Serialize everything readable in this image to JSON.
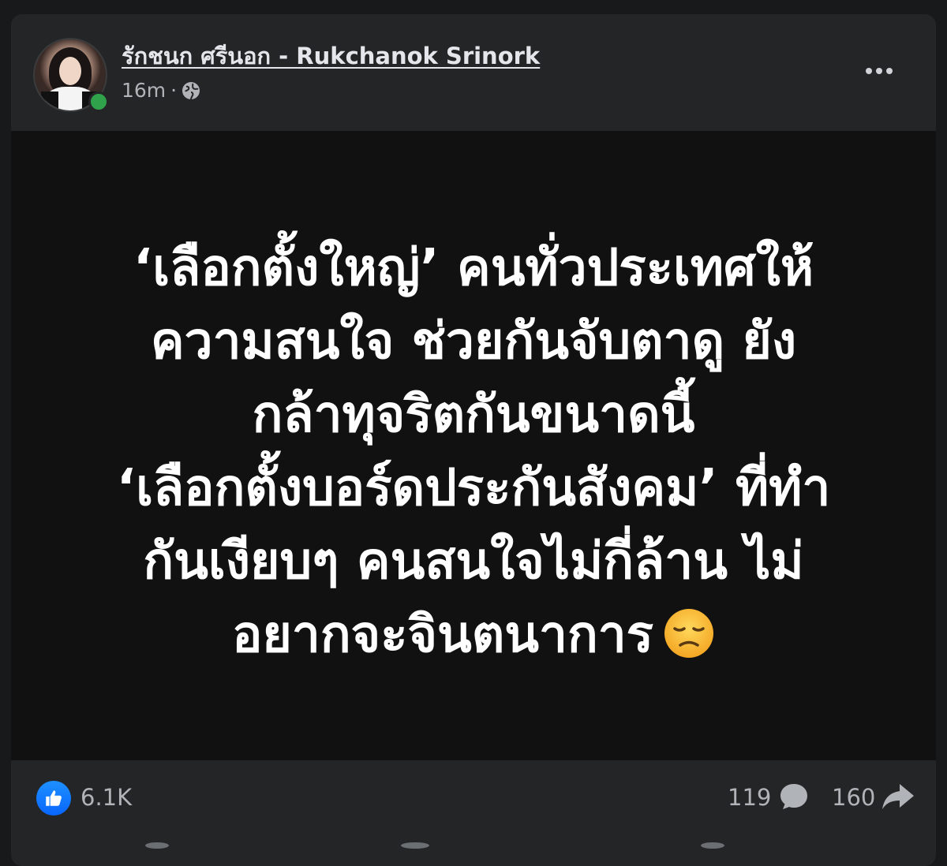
{
  "post": {
    "author_name": "รักชนก ศรีนอก - Rukchanok Srinork",
    "timestamp": "16m",
    "separator": "·",
    "privacy_icon": "globe-icon",
    "online_status_color": "#31a24c",
    "more_icon": "more-horizontal-icon",
    "image_text_lines": [
      "‘เลือกตั้งใหญ่’ คนทั่วประเทศให้",
      "ความสนใจ ช่วยกันจับตาดู ยัง",
      "กล้าทุจริตกันขนาดนี้",
      "‘เลือกตั้งบอร์ดประกันสังคม’ ที่ทำ",
      "กันเงียบๆ คนสนใจไม่กี่ล้าน ไม่",
      "อยากจะจินตนาการ"
    ],
    "image_emoji": "disappointed-face-emoji"
  },
  "engagement": {
    "like_icon": "like-icon",
    "like_count": "6.1K",
    "comment_count": "119",
    "comment_icon": "comment-icon",
    "share_count": "160",
    "share_icon": "share-icon"
  },
  "colors": {
    "background": "#18191a",
    "card": "#242526",
    "image_background": "#111111",
    "text_primary": "#e4e6eb",
    "text_secondary": "#b0b3b8",
    "like_blue": "#0866ff"
  }
}
